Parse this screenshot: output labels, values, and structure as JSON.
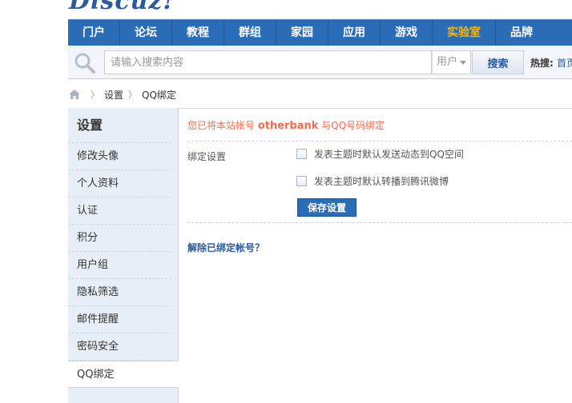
{
  "logo": {
    "text": "Discuz!"
  },
  "nav": {
    "items": [
      {
        "label": "门户"
      },
      {
        "label": "论坛"
      },
      {
        "label": "教程"
      },
      {
        "label": "群组"
      },
      {
        "label": "家园"
      },
      {
        "label": "应用"
      },
      {
        "label": "游戏"
      },
      {
        "label": "实验室"
      },
      {
        "label": "品牌"
      }
    ],
    "active_label": "实验室",
    "active_color": "#ffb400",
    "bar_color": "#2b6cb6"
  },
  "search": {
    "placeholder": "请输入搜索内容",
    "type_label": "用户",
    "button_label": "搜索",
    "hot_label": "热搜:",
    "hot_link": "首页"
  },
  "breadcrumb": {
    "items": [
      "设置",
      "QQ绑定"
    ]
  },
  "sidebar": {
    "title": "设置",
    "items": [
      {
        "label": "修改头像"
      },
      {
        "label": "个人资料"
      },
      {
        "label": "认证"
      },
      {
        "label": "积分"
      },
      {
        "label": "用户组"
      },
      {
        "label": "隐私筛选"
      },
      {
        "label": "邮件提醒"
      },
      {
        "label": "密码安全"
      },
      {
        "label": "QQ绑定"
      }
    ],
    "active_label": "QQ绑定"
  },
  "main": {
    "notice_prefix": "您已将本站帐号",
    "notice_account": "otherbank",
    "notice_suffix": "与QQ号码绑定",
    "notice_color": "#f26c4f",
    "bind_settings_label": "绑定设置",
    "options": [
      {
        "label": "发表主题时默认发送动态到QQ空间",
        "checked": false
      },
      {
        "label": "发表主题时默认转播到腾讯微博",
        "checked": false
      }
    ],
    "save_label": "保存设置",
    "unbind_label": "解除已绑定帐号？"
  }
}
